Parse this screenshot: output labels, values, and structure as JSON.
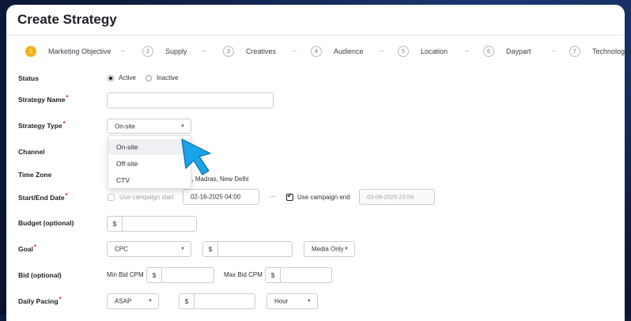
{
  "page": {
    "title": "Create Strategy"
  },
  "steps": [
    {
      "num": "1",
      "label": "Marketing Objective",
      "active": true
    },
    {
      "num": "2",
      "label": "Supply"
    },
    {
      "num": "3",
      "label": "Creatives"
    },
    {
      "num": "4",
      "label": "Audience"
    },
    {
      "num": "5",
      "label": "Location"
    },
    {
      "num": "6",
      "label": "Daypart"
    },
    {
      "num": "7",
      "label": "Technology"
    }
  ],
  "step_separator": "–",
  "form": {
    "status": {
      "label": "Status",
      "options": [
        "Active",
        "Inactive"
      ],
      "selected": "Active"
    },
    "strategy_name": {
      "label": "Strategy Name",
      "required": "*",
      "value": ""
    },
    "strategy_type": {
      "label": "Strategy Type",
      "required": "*",
      "value": "On-site",
      "options": [
        "On-site",
        "Off-site",
        "CTV"
      ],
      "highlighted": "On-site"
    },
    "channel": {
      "label": "Channel"
    },
    "time_zone": {
      "label": "Time Zone",
      "value_partial": "a, Madras, New Delhi"
    },
    "dates": {
      "label": "Start/End Date",
      "required": "*",
      "use_campaign_start": "Use campaign start",
      "use_campaign_start_checked": false,
      "start_value": "02-16-2025 04:00",
      "dash": "—",
      "use_campaign_end": "Use campaign end",
      "use_campaign_end_checked": true,
      "end_value": "03-06-2025 23:59"
    },
    "budget": {
      "label": "Budget (optional)",
      "prefix": "$",
      "value": ""
    },
    "goal": {
      "label": "Goal",
      "required": "*",
      "type": "CPC",
      "prefix": "$",
      "value": "",
      "media": "Media Only"
    },
    "bid": {
      "label": "Bid (optional)",
      "min_label": "Min Bid CPM",
      "max_label": "Max Bid CPM",
      "prefix": "$"
    },
    "daily_pacing": {
      "label": "Daily Pacing",
      "required": "*",
      "mode": "ASAP",
      "prefix": "$",
      "unit": "Hour"
    }
  },
  "icons": {
    "caret": "caret-down-icon",
    "cursor": "pointer-arrow-icon"
  },
  "colors": {
    "active_step": "#f2b21b",
    "required": "#d93025",
    "cursor": "#1aa3e8",
    "background": "#0d1b3d"
  }
}
